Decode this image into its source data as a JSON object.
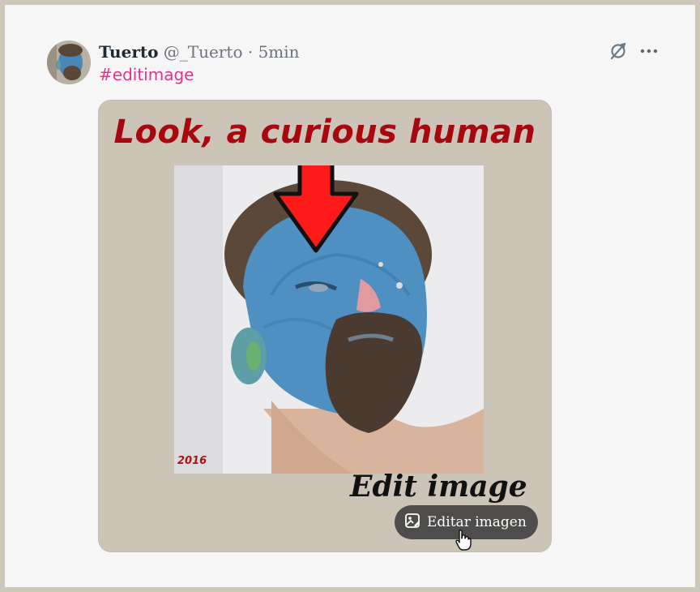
{
  "post": {
    "author_name": "Tuerto",
    "handle": "@_Tuerto",
    "separator": "·",
    "time": "5min",
    "hashtag": "#editimage"
  },
  "icons": {
    "no_sync": "no-sync-icon",
    "more": "more-dots-icon",
    "edit_image": "image-edit-icon",
    "cursor": "pointer-hand-icon"
  },
  "image": {
    "title": "Look, a curious human",
    "year": "2016",
    "caption": "Edit image"
  },
  "edit_button": {
    "label": "Editar imagen"
  },
  "colors": {
    "hashtag": "#e2338d",
    "title": "#a8070f",
    "arrow": "#ff1a1a"
  }
}
